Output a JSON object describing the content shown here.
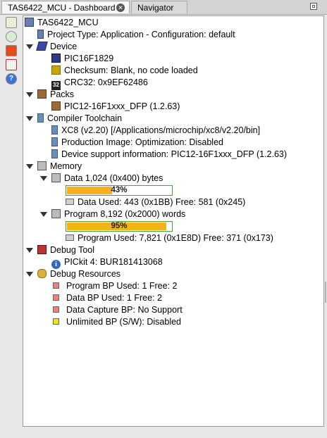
{
  "tabs": [
    {
      "label": "TAS6422_MCU - Dashboard",
      "active": true
    },
    {
      "label": "Navigator",
      "active": false
    }
  ],
  "toolbar": {
    "icons": [
      "project-properties-icon",
      "refresh-icon",
      "hardware-tool-icon",
      "pdf-icon",
      "help-icon"
    ]
  },
  "tree": {
    "project_name": "TAS6422_MCU",
    "project_type": "Project Type: Application - Configuration: default",
    "device": {
      "label": "Device",
      "name": "PIC16F1829",
      "checksum": "Checksum: Blank, no code loaded",
      "crc": "CRC32: 0x9EF62486",
      "crc_badge": "32"
    },
    "packs": {
      "label": "Packs",
      "item": "PIC12-16F1xxx_DFP (1.2.63)"
    },
    "compiler": {
      "label": "Compiler Toolchain",
      "xc8": "XC8 (v2.20) [/Applications/microchip/xc8/v2.20/bin]",
      "production": "Production Image: Optimization: Disabled",
      "device_support": "Device support information: PIC12-16F1xxx_DFP (1.2.63)"
    },
    "memory": {
      "label": "Memory",
      "data": {
        "label": "Data 1,024 (0x400) bytes",
        "percent": 43,
        "percent_label": "43%",
        "used": "Data Used: 443 (0x1BB) Free: 581 (0x245)"
      },
      "program": {
        "label": "Program 8,192 (0x2000) words",
        "percent": 95,
        "percent_label": "95%",
        "used": "Program Used: 7,821 (0x1E8D) Free: 371 (0x173)"
      }
    },
    "debug_tool": {
      "label": "Debug Tool",
      "item": "PICkit 4: BUR181413068"
    },
    "debug_resources": {
      "label": "Debug Resources",
      "items": [
        {
          "text": "Program BP Used: 1  Free: 2",
          "color": "#f08080"
        },
        {
          "text": "Data BP Used: 1  Free: 2",
          "color": "#f08080"
        },
        {
          "text": "Data Capture BP: No Support",
          "color": "#f08080"
        },
        {
          "text": "Unlimited BP (S/W): Disabled",
          "color": "#f5e400"
        }
      ]
    }
  },
  "colors": {
    "progress_fill": "#f6b21a",
    "progress_border": "#4aa33a"
  }
}
